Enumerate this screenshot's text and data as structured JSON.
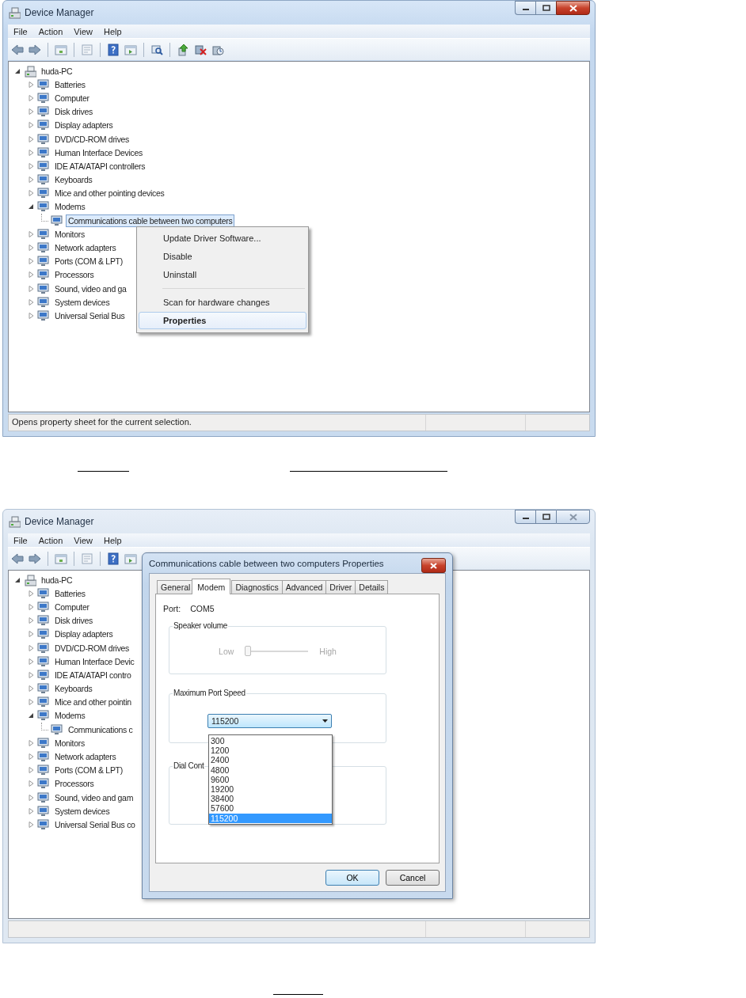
{
  "windows": [
    {
      "title": "Device Manager",
      "active": true,
      "menu": [
        "File",
        "Action",
        "View",
        "Help"
      ],
      "tree": {
        "label": "huda-PC",
        "expanded": true,
        "selected": false,
        "children": [
          {
            "label": "Batteries",
            "expanded": false,
            "selected": false
          },
          {
            "label": "Computer",
            "expanded": false,
            "selected": false
          },
          {
            "label": "Disk drives",
            "expanded": false,
            "selected": false
          },
          {
            "label": "Display adapters",
            "expanded": false,
            "selected": false
          },
          {
            "label": "DVD/CD-ROM drives",
            "expanded": false,
            "selected": false
          },
          {
            "label": "Human Interface Devices",
            "expanded": false,
            "selected": false
          },
          {
            "label": "IDE ATA/ATAPI controllers",
            "expanded": false,
            "selected": false
          },
          {
            "label": "Keyboards",
            "expanded": false,
            "selected": false
          },
          {
            "label": "Mice and other pointing devices",
            "expanded": false,
            "selected": false
          },
          {
            "label": "Modems",
            "expanded": true,
            "selected": false,
            "children": [
              {
                "label": "Communications cable between two computers",
                "selected": true
              }
            ]
          },
          {
            "label": "Monitors",
            "expanded": false,
            "selected": false
          },
          {
            "label": "Network adapters",
            "expanded": false,
            "selected": false
          },
          {
            "label": "Ports (COM & LPT)",
            "expanded": false,
            "selected": false
          },
          {
            "label": "Processors",
            "expanded": false,
            "selected": false
          },
          {
            "label": "Sound, video and ga",
            "expanded": false,
            "selected": false
          },
          {
            "label": "System devices",
            "expanded": false,
            "selected": false
          },
          {
            "label": "Universal Serial Bus",
            "expanded": false,
            "selected": false
          }
        ]
      },
      "context_menu": {
        "items": [
          {
            "kind": "command",
            "label": "Update Driver Software...",
            "default": false,
            "selected": false
          },
          {
            "kind": "command",
            "label": "Disable",
            "default": false,
            "selected": false
          },
          {
            "kind": "command",
            "label": "Uninstall",
            "default": false,
            "selected": false
          },
          {
            "kind": "separator"
          },
          {
            "kind": "command",
            "label": "Scan for hardware changes",
            "default": false,
            "selected": false
          },
          {
            "kind": "command",
            "label": "Properties",
            "default": true,
            "selected": true
          }
        ]
      },
      "status_bar": {
        "text": "Opens property sheet for the current selection."
      }
    },
    {
      "title": "Device Manager",
      "active": false,
      "menu": [
        "File",
        "Action",
        "View",
        "Help"
      ],
      "tree": {
        "label": "huda-PC",
        "expanded": true,
        "selected": false,
        "children": [
          {
            "label": "Batteries",
            "expanded": false,
            "selected": false
          },
          {
            "label": "Computer",
            "expanded": false,
            "selected": false
          },
          {
            "label": "Disk drives",
            "expanded": false,
            "selected": false
          },
          {
            "label": "Display adapters",
            "expanded": false,
            "selected": false
          },
          {
            "label": "DVD/CD-ROM drives",
            "expanded": false,
            "selected": false
          },
          {
            "label": "Human Interface Devic",
            "expanded": false,
            "selected": false
          },
          {
            "label": "IDE ATA/ATAPI contro",
            "expanded": false,
            "selected": false
          },
          {
            "label": "Keyboards",
            "expanded": false,
            "selected": false
          },
          {
            "label": "Mice and other pointin",
            "expanded": false,
            "selected": false
          },
          {
            "label": "Modems",
            "expanded": true,
            "selected": false,
            "children": [
              {
                "label": "Communications c",
                "selected": false
              }
            ]
          },
          {
            "label": "Monitors",
            "expanded": false,
            "selected": false
          },
          {
            "label": "Network adapters",
            "expanded": false,
            "selected": false
          },
          {
            "label": "Ports (COM & LPT)",
            "expanded": false,
            "selected": false
          },
          {
            "label": "Processors",
            "expanded": false,
            "selected": false
          },
          {
            "label": "Sound, video and gam",
            "expanded": false,
            "selected": false
          },
          {
            "label": "System devices",
            "expanded": false,
            "selected": false
          },
          {
            "label": "Universal Serial Bus co",
            "expanded": false,
            "selected": false
          }
        ]
      },
      "dialog": {
        "title": "Communications cable between two computers Properties",
        "tabs": [
          {
            "label": "General",
            "selected": false
          },
          {
            "label": "Modem",
            "selected": true
          },
          {
            "label": "Diagnostics",
            "selected": false
          },
          {
            "label": "Advanced",
            "selected": false
          },
          {
            "label": "Driver",
            "selected": false
          },
          {
            "label": "Details",
            "selected": false
          }
        ],
        "port_label": "Port:",
        "port_value": "COM5",
        "speaker_volume": {
          "title": "Speaker volume",
          "low_label": "Low",
          "high_label": "High",
          "level": 0,
          "disabled": true
        },
        "port_speed": {
          "title": "Maximum Port Speed",
          "value": "115200",
          "open": true,
          "options": [
            {
              "label": "300",
              "selected": false
            },
            {
              "label": "1200",
              "selected": false
            },
            {
              "label": "2400",
              "selected": false
            },
            {
              "label": "4800",
              "selected": false
            },
            {
              "label": "9600",
              "selected": false
            },
            {
              "label": "19200",
              "selected": false
            },
            {
              "label": "38400",
              "selected": false
            },
            {
              "label": "57600",
              "selected": false
            },
            {
              "label": "115200",
              "selected": true
            }
          ]
        },
        "dial_control": {
          "title": "Dial Cont"
        },
        "buttons": [
          {
            "label": "OK",
            "default": true
          },
          {
            "label": "Cancel",
            "default": false
          }
        ]
      }
    }
  ]
}
